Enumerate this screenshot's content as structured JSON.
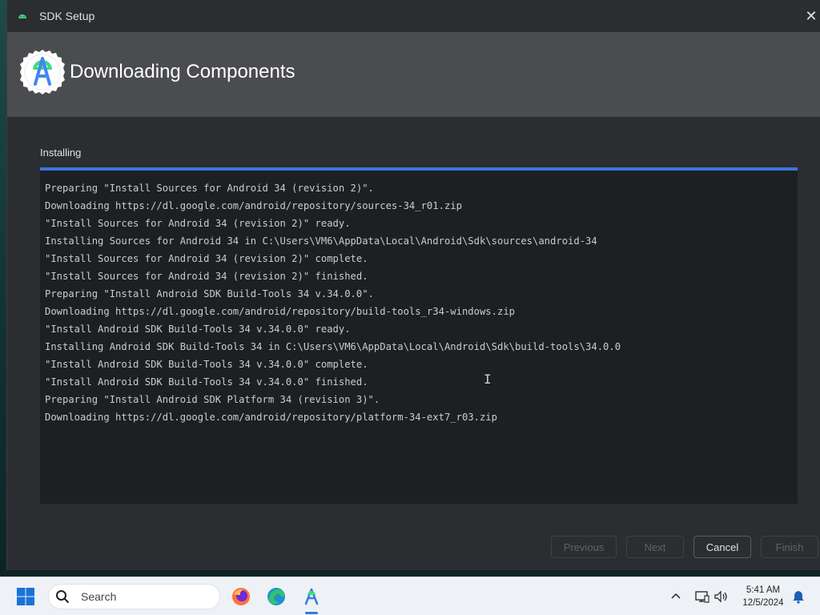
{
  "window": {
    "title": "SDK Setup",
    "close_glyph": "✕",
    "icon": "android-studio-icon"
  },
  "header": {
    "heading": "Downloading Components",
    "logo": "android-studio-logo"
  },
  "status": {
    "label": "Installing",
    "progress": 1.0
  },
  "log": {
    "lines": [
      "Preparing \"Install Sources for Android 34 (revision 2)\".",
      "Downloading https://dl.google.com/android/repository/sources-34_r01.zip",
      "\"Install Sources for Android 34 (revision 2)\" ready.",
      "Installing Sources for Android 34 in C:\\Users\\VM6\\AppData\\Local\\Android\\Sdk\\sources\\android-34",
      "\"Install Sources for Android 34 (revision 2)\" complete.",
      "\"Install Sources for Android 34 (revision 2)\" finished.",
      "Preparing \"Install Android SDK Build-Tools 34 v.34.0.0\".",
      "Downloading https://dl.google.com/android/repository/build-tools_r34-windows.zip",
      "\"Install Android SDK Build-Tools 34 v.34.0.0\" ready.",
      "Installing Android SDK Build-Tools 34 in C:\\Users\\VM6\\AppData\\Local\\Android\\Sdk\\build-tools\\34.0.0",
      "\"Install Android SDK Build-Tools 34 v.34.0.0\" complete.",
      "\"Install Android SDK Build-Tools 34 v.34.0.0\" finished.",
      "Preparing \"Install Android SDK Platform 34 (revision 3)\".",
      "Downloading https://dl.google.com/android/repository/platform-34-ext7_r03.zip"
    ]
  },
  "buttons": {
    "previous": "Previous",
    "next": "Next",
    "cancel": "Cancel",
    "finish": "Finish"
  },
  "taskbar": {
    "search_label": "Search",
    "apps": [
      "firefox-icon",
      "edge-icon",
      "android-studio-icon"
    ],
    "time": "5:41 AM",
    "date": "12/5/2024"
  },
  "colors": {
    "accent": "#3d74e0",
    "window_bg": "#2b2d30",
    "header_bg": "#4a4c4f",
    "log_bg": "#1e1f22"
  }
}
